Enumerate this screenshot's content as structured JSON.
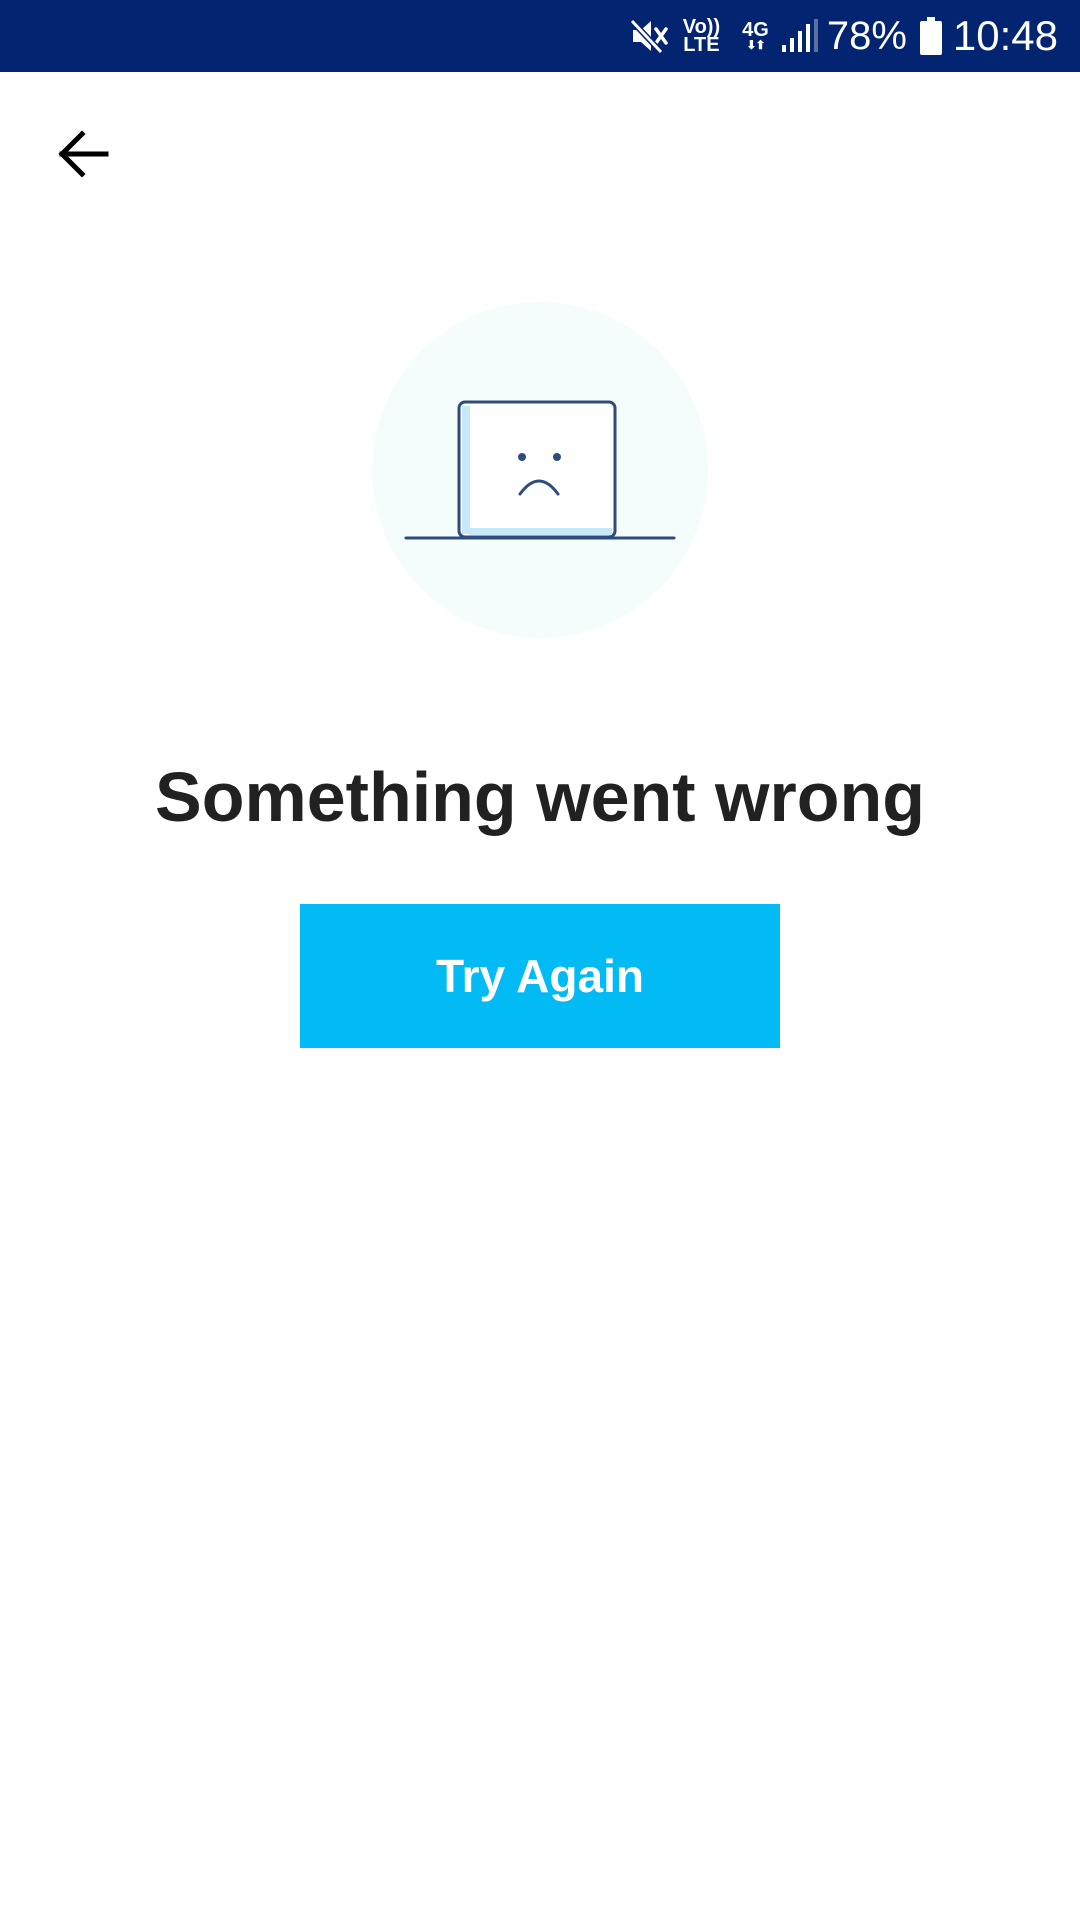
{
  "status_bar": {
    "volte_top": "Vo))",
    "volte_bottom": "LTE",
    "network_type": "4G",
    "battery_percent": "78%",
    "time": "10:48",
    "background_color": "#032470",
    "icons": [
      "mute-icon",
      "volte-icon",
      "network-4g-icon",
      "signal-icon",
      "battery-icon"
    ]
  },
  "header": {
    "back_icon": "arrow-left-icon"
  },
  "error": {
    "illustration_icon": "sad-laptop-icon",
    "title": "Something went wrong",
    "button_label": "Try Again",
    "button_color": "#03bbf4",
    "title_color": "#212121"
  }
}
